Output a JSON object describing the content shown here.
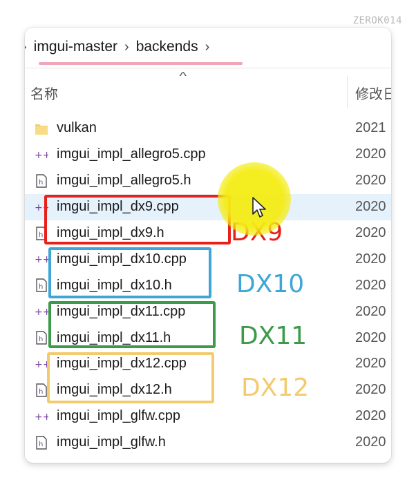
{
  "watermark": "ZEROK014",
  "breadcrumb": {
    "items": [
      "imgui-master",
      "backends"
    ]
  },
  "columns": {
    "name": "名称",
    "date_modified": "修改日"
  },
  "files": [
    {
      "name": "vulkan",
      "type": "folder",
      "date": "2021"
    },
    {
      "name": "imgui_impl_allegro5.cpp",
      "type": "cpp",
      "date": "2020"
    },
    {
      "name": "imgui_impl_allegro5.h",
      "type": "h",
      "date": "2020"
    },
    {
      "name": "imgui_impl_dx9.cpp",
      "type": "cpp",
      "date": "2020"
    },
    {
      "name": "imgui_impl_dx9.h",
      "type": "h",
      "date": "2020"
    },
    {
      "name": "imgui_impl_dx10.cpp",
      "type": "cpp",
      "date": "2020"
    },
    {
      "name": "imgui_impl_dx10.h",
      "type": "h",
      "date": "2020"
    },
    {
      "name": "imgui_impl_dx11.cpp",
      "type": "cpp",
      "date": "2020"
    },
    {
      "name": "imgui_impl_dx11.h",
      "type": "h",
      "date": "2020"
    },
    {
      "name": "imgui_impl_dx12.cpp",
      "type": "cpp",
      "date": "2020"
    },
    {
      "name": "imgui_impl_dx12.h",
      "type": "h",
      "date": "2020"
    },
    {
      "name": "imgui_impl_glfw.cpp",
      "type": "cpp",
      "date": "2020"
    },
    {
      "name": "imgui_impl_glfw.h",
      "type": "h",
      "date": "2020"
    }
  ],
  "annotations": [
    {
      "label": "DX9",
      "color": "#e8201a"
    },
    {
      "label": "DX10",
      "color": "#3ea6d6"
    },
    {
      "label": "DX11",
      "color": "#3c9a4b"
    },
    {
      "label": "DX12",
      "color": "#f2cb6e"
    }
  ],
  "colors": {
    "selected_row": "#e5f1fb",
    "cursor_halo": "#f4ec14",
    "breadcrumb_underline": "#f0a5b8"
  }
}
